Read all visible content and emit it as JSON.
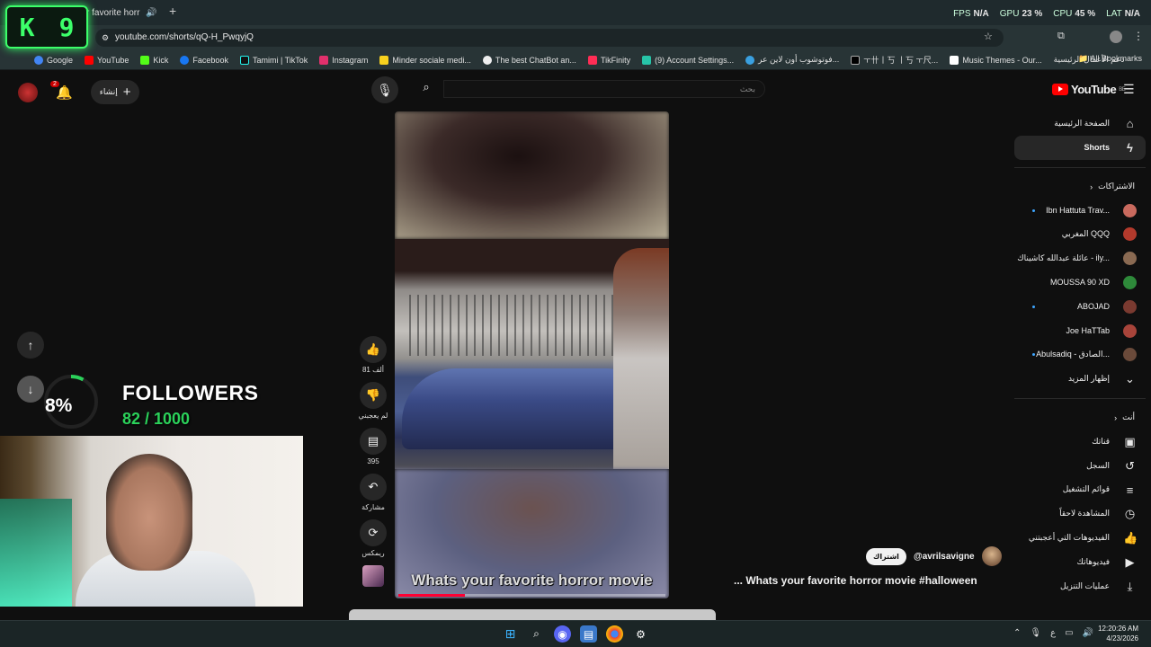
{
  "browser": {
    "tab_title": "r favorite horr",
    "url": "youtube.com/shorts/qQ-H_PwqyjQ",
    "bookmarks": [
      "Google",
      "YouTube",
      "Kick",
      "Facebook",
      "Tamimi | TikTok",
      "Instagram",
      "Minder sociale medi...",
      "The best ChatBot an...",
      "TikFinity",
      "(9) Account Settings...",
      "فوتوشوب أون لاين عر...",
      "ㅜ卄丨丂 丨丂 ㅜ尺...",
      "Music Themes - Our...",
      "دعم الأعمال الرئيسية"
    ],
    "all_bookmarks": "All Bookmarks"
  },
  "overlay": {
    "k9_left": "K",
    "k9_right": "9",
    "stats": {
      "fps_label": "FPS",
      "fps": "N/A",
      "gpu_label": "GPU",
      "gpu": "23 %",
      "cpu_label": "CPU",
      "cpu": "45 %",
      "lat_label": "LAT",
      "lat": "N/A"
    },
    "followers_title": "FOLLOWERS",
    "followers_count": "82 / 1000",
    "followers_pct": "8%",
    "followers_progress": 0.08
  },
  "youtube": {
    "logo": "YouTube",
    "region": "BE",
    "search_placeholder": "بحث",
    "create_label": "إنشاء",
    "notifications_count": "2",
    "sidebar": {
      "home": "الصفحة الرئيسية",
      "shorts": "Shorts",
      "subscriptions_header": "الاشتراكات",
      "subscriptions": [
        {
          "name": "Ibn Hattuta Trav...",
          "dot": true,
          "color": "#c96a5e"
        },
        {
          "name": "المغربي QQQ",
          "dot": false,
          "color": "#b33a2c"
        },
        {
          "name": "عائلة عبدالله كاشيناك - ily...",
          "dot": false,
          "color": "#8a6a52"
        },
        {
          "name": "MOUSSA 90 XD",
          "dot": false,
          "color": "#2e8a3a"
        },
        {
          "name": "ABOJAD",
          "dot": true,
          "color": "#7a3a30"
        },
        {
          "name": "Joe HaTTab",
          "dot": false,
          "color": "#a8443a"
        },
        {
          "name": "Abulsadiq - الصادق...",
          "dot": true,
          "color": "#6a4a3a"
        }
      ],
      "show_more": "إظهار المزيد",
      "you_header": "أنت",
      "you_items": [
        "قناتك",
        "السجل",
        "قوائم التشغيل",
        "المشاهدة لاحقاً",
        "الفيديوهات التي أعجبتني",
        "فيديوهاتك",
        "عمليات التنزيل"
      ]
    },
    "short": {
      "caption": "Whats your favorite horror movie",
      "progress": 0.25,
      "likes": "81 ألف",
      "dislike_label": "لم يعجبني",
      "comments": "395",
      "share_label": "مشاركة",
      "remix_label": "ريمكس",
      "channel": "@avrilsavigne",
      "subscribe": "اشتراك",
      "title": "... Whats your favorite horror movie #halloween"
    }
  },
  "taskbar": {
    "time": "12:20:26 AM",
    "date": "4/23/2026",
    "lang": "ع"
  }
}
